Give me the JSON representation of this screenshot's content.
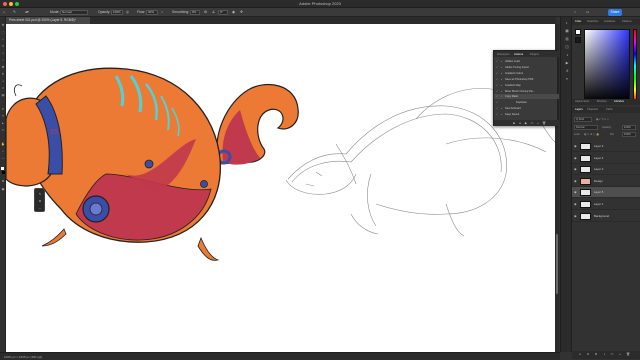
{
  "window": {
    "title": "Adobe Photoshop 2023"
  },
  "options_bar": {
    "mode_label": "Mode:",
    "mode_value": "Normal",
    "opacity_label": "Opacity:",
    "opacity_value": "100%",
    "flow_label": "Flow:",
    "flow_value": "30%",
    "smoothing_label": "Smoothing:",
    "smoothing_value": "0%",
    "angle_value": "0°",
    "share_label": "Share"
  },
  "document": {
    "tab_label": "Pres sheet 001.psd @ 200% (Layer 5, RGB/8)*",
    "status": "100% px x 1635 px (300 ppi)"
  },
  "actions_panel": {
    "tabs": [
      "Histogram",
      "Actions",
      "Plugins"
    ],
    "active_tab": "Actions",
    "rows": [
      {
        "label": "Hidden Load",
        "expand": "▸"
      },
      {
        "label": "Adobe Tuning Import",
        "expand": "▸"
      },
      {
        "label": "Gradient Colors",
        "expand": "▸"
      },
      {
        "label": "Save as Photoshop PDF",
        "expand": "▸"
      },
      {
        "label": "Gradient Map",
        "expand": "▸"
      },
      {
        "label": "Mixer Brush Cloning Pai...",
        "expand": "▸"
      },
      {
        "label": "Copy Mask",
        "expand": "▾",
        "selected": true
      },
      {
        "label": "Duplicate",
        "expand": ""
      },
      {
        "label": "New Artboard",
        "expand": "▸"
      },
      {
        "label": "Keep Saved",
        "expand": "▸"
      }
    ]
  },
  "side_strip": {
    "icons": [
      "palette-icon",
      "swatches-icon",
      "gradient-icon",
      "layers-icon",
      "adjustments-icon",
      "play-icon",
      "history-icon",
      "properties-icon"
    ]
  },
  "right_panel": {
    "color_tabs": [
      "Color",
      "Swatches",
      "Gradients",
      "Patterns"
    ],
    "active_color_tab": "Color",
    "foreground_color": "#ffffff",
    "background_color": "#1a1a1a",
    "adjust_tabs": [
      "Adjustments",
      "Brushes",
      "Libraries"
    ],
    "layer_tabs": [
      "Layers",
      "Channels",
      "Paths"
    ],
    "active_layer_tab": "Layers",
    "kind_filter": "Q Kind",
    "blend_mode": "Normal",
    "opacity_label": "Opacity:",
    "opacity_value": "100%",
    "lock_label": "Lock:",
    "fill_label": "Fill:",
    "fill_value": "100%",
    "layers": [
      {
        "name": "Layer 3",
        "selected": false
      },
      {
        "name": "Layer 4",
        "selected": false
      },
      {
        "name": "Layer 2",
        "selected": false
      },
      {
        "name": "Design",
        "selected": false
      },
      {
        "name": "Layer 5",
        "selected": true
      },
      {
        "name": "Layer 1",
        "selected": false
      },
      {
        "name": "Background",
        "selected": false
      }
    ]
  },
  "colors": {
    "accent": "#2d7be5",
    "creature_body": "#ec7a34",
    "creature_shadow": "#c0394d",
    "collar": "#3a4ea8",
    "stripes": "#4fd2d8"
  }
}
